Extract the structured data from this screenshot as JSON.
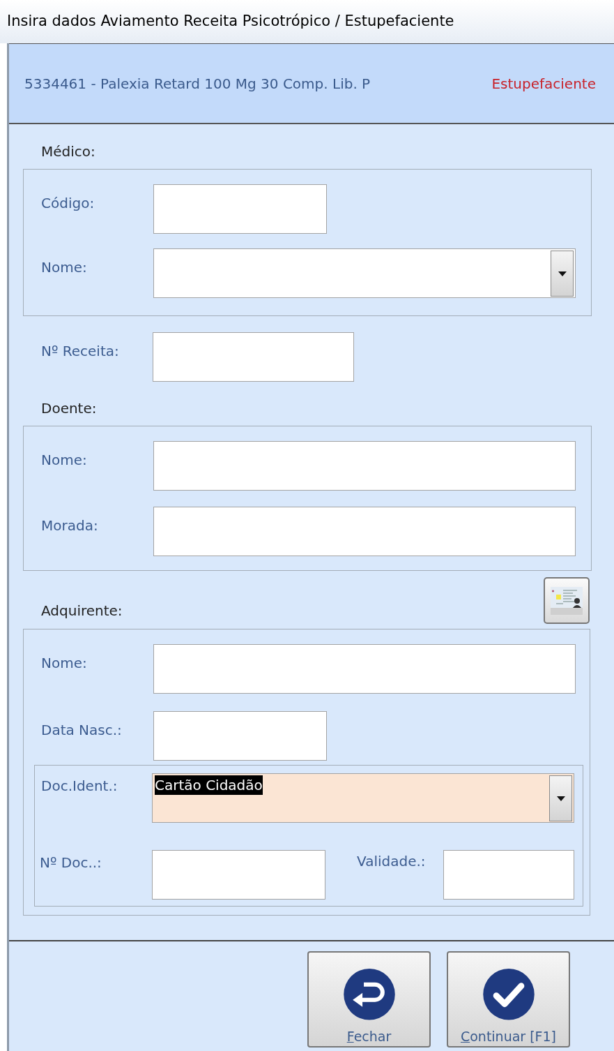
{
  "window": {
    "title": "Insira dados Aviamento Receita Psicotrópico / Estupefaciente"
  },
  "header": {
    "product": "5334461 - Palexia Retard 100 Mg 30 Comp. Lib. P",
    "category": "Estupefaciente"
  },
  "medico": {
    "label": "Médico:",
    "fields": [
      {
        "label": "Código:",
        "kind": "short"
      },
      {
        "label": "Nome:",
        "kind": "combo"
      }
    ]
  },
  "receita": {
    "label": "Nº Receita:"
  },
  "doente": {
    "label": "Doente:",
    "fields": [
      {
        "label": "Nome:",
        "kind": "text"
      },
      {
        "label": "Morada:",
        "kind": "text"
      }
    ]
  },
  "adquirente": {
    "label": "Adquirente:",
    "fields": [
      {
        "label": "Nome:",
        "kind": "text"
      },
      {
        "label": "Data Nasc.:",
        "kind": "short"
      }
    ],
    "documento": {
      "type": {
        "label": "Doc.Ident.:",
        "value": "Cartão Cidadão",
        "highlighted": true
      },
      "number": {
        "label": "Nº Doc..:"
      },
      "validity": {
        "label": "Validade.:"
      }
    }
  },
  "buttons": [
    {
      "label": "Fechar",
      "kind": "close",
      "access_key": true
    },
    {
      "label": "Continuar [F1]",
      "kind": "confirm",
      "access_key": true
    }
  ]
}
